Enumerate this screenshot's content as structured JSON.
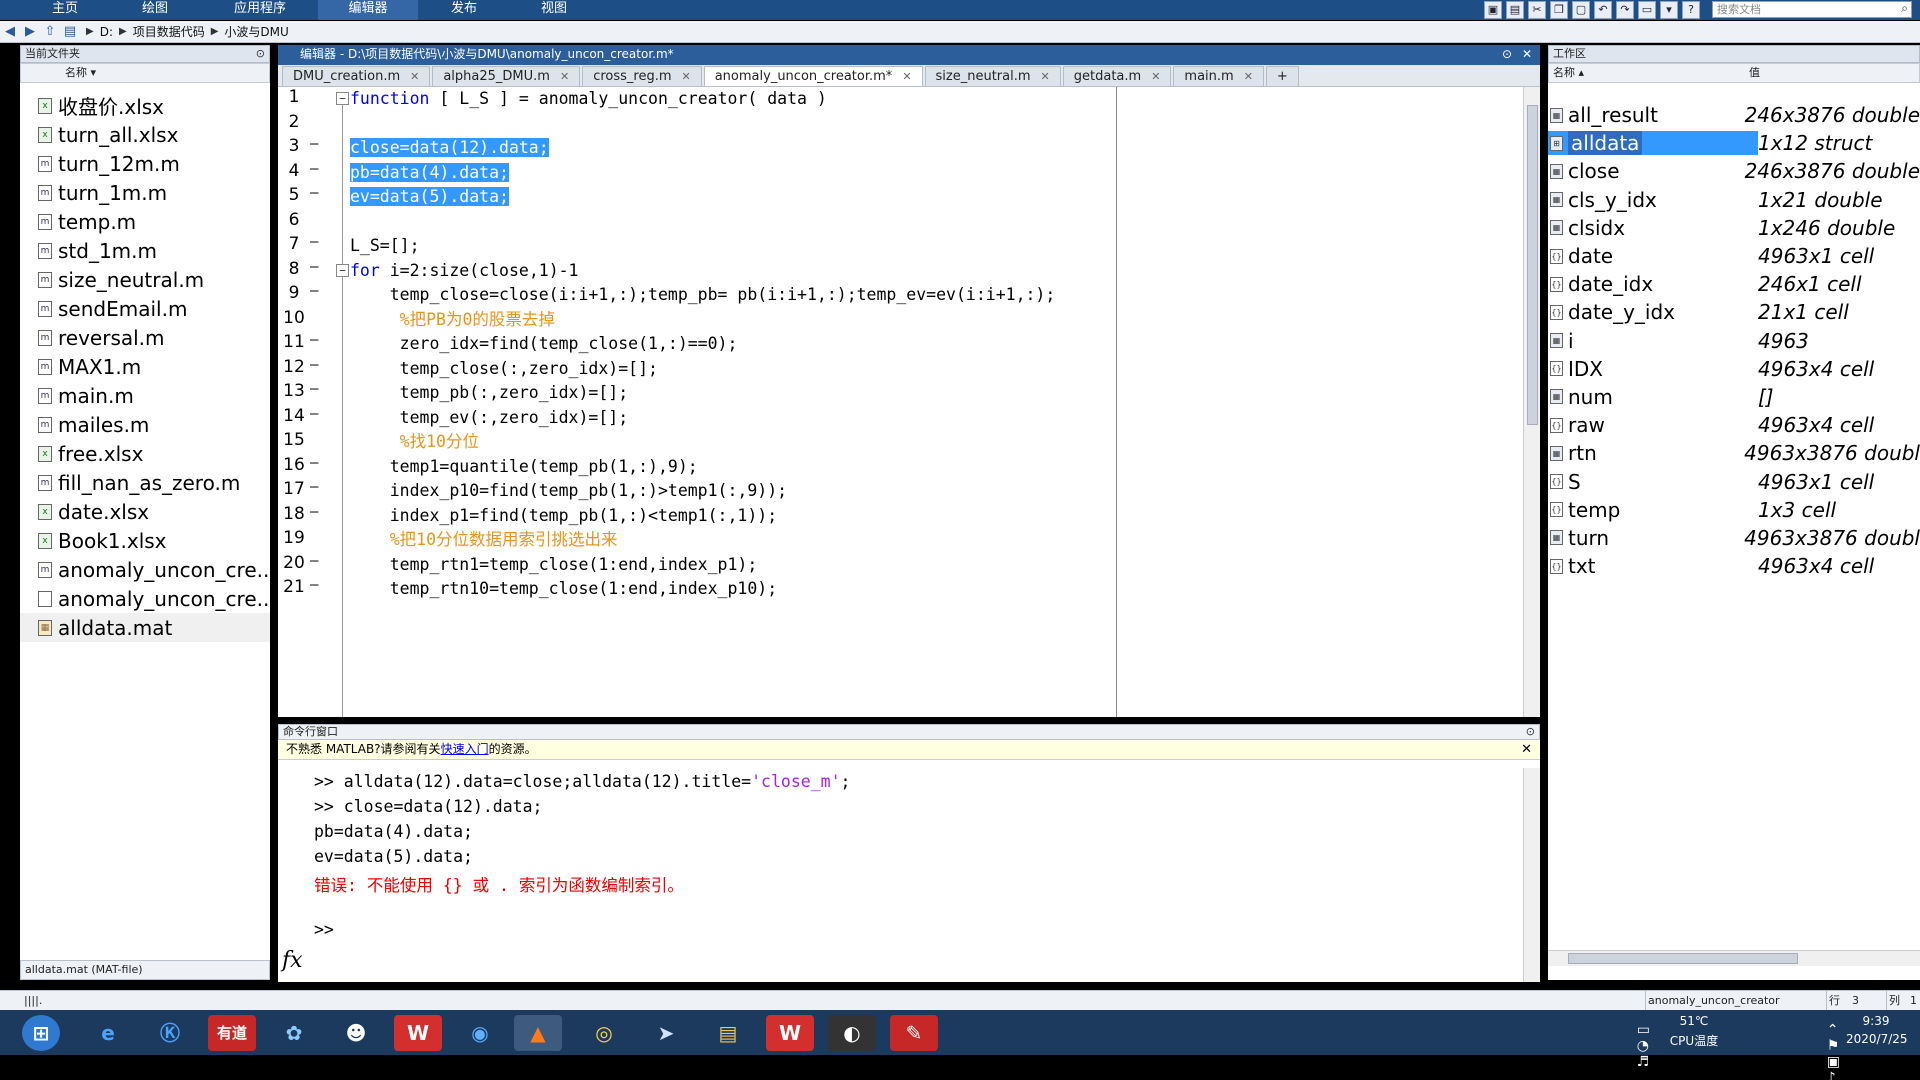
{
  "ribbon": {
    "tabs": [
      "主页",
      "绘图",
      "应用程序",
      "编辑器",
      "发布",
      "视图"
    ],
    "active_tab": "编辑器",
    "search_placeholder": "搜索文档"
  },
  "address": {
    "crumbs": [
      "D:",
      "项目数据代码",
      "小波与DMU"
    ]
  },
  "current_folder": {
    "title": "当前文件夹",
    "column_name": "名称 ▾",
    "files": [
      {
        "name": "收盘价.xlsx",
        "type": "xlsx"
      },
      {
        "name": "turn_all.xlsx",
        "type": "xlsx"
      },
      {
        "name": "turn_12m.m",
        "type": "m"
      },
      {
        "name": "turn_1m.m",
        "type": "m"
      },
      {
        "name": "temp.m",
        "type": "m"
      },
      {
        "name": "std_1m.m",
        "type": "m"
      },
      {
        "name": "size_neutral.m",
        "type": "m"
      },
      {
        "name": "sendEmail.m",
        "type": "m"
      },
      {
        "name": "reversal.m",
        "type": "m"
      },
      {
        "name": "MAX1.m",
        "type": "m"
      },
      {
        "name": "main.m",
        "type": "m"
      },
      {
        "name": "mailes.m",
        "type": "m"
      },
      {
        "name": "free.xlsx",
        "type": "xlsx"
      },
      {
        "name": "fill_nan_as_zero.m",
        "type": "m"
      },
      {
        "name": "date.xlsx",
        "type": "xlsx"
      },
      {
        "name": "Book1.xlsx",
        "type": "xlsx"
      },
      {
        "name": "anomaly_uncon_cre...",
        "type": "m"
      },
      {
        "name": "anomaly_uncon_cre...",
        "type": "asv"
      },
      {
        "name": "alldata.mat",
        "type": "mat"
      }
    ],
    "selected_file": "alldata.mat",
    "details": "alldata.mat  (MAT-file)"
  },
  "editor": {
    "title": "编辑器 - D:\\项目数据代码\\小波与DMU\\anomaly_uncon_creator.m*",
    "tabs": [
      "DMU_creation.m",
      "alpha25_DMU.m",
      "cross_reg.m",
      "anomaly_uncon_creator.m*",
      "size_neutral.m",
      "getdata.m",
      "main.m"
    ],
    "active_tab": "anomaly_uncon_creator.m*",
    "add_tab": "+",
    "lines": [
      {
        "n": "1",
        "code": "function [ L_S ] = anomaly_uncon_creator( data )"
      },
      {
        "n": "2",
        "code": ""
      },
      {
        "n": "3",
        "code": "close=data(12).data;"
      },
      {
        "n": "4",
        "code": "pb=data(4).data;"
      },
      {
        "n": "5",
        "code": "ev=data(5).data;"
      },
      {
        "n": "6",
        "code": ""
      },
      {
        "n": "7",
        "code": "L_S=[];"
      },
      {
        "n": "8",
        "code": "for i=2:size(close,1)-1"
      },
      {
        "n": "9",
        "code": "    temp_close=close(i:i+1,:);temp_pb= pb(i:i+1,:);temp_ev=ev(i:i+1,:);"
      },
      {
        "n": "10",
        "code": "     %把PB为0的股票去掉"
      },
      {
        "n": "11",
        "code": "     zero_idx=find(temp_close(1,:)==0);"
      },
      {
        "n": "12",
        "code": "     temp_close(:,zero_idx)=[];"
      },
      {
        "n": "13",
        "code": "     temp_pb(:,zero_idx)=[];"
      },
      {
        "n": "14",
        "code": "     temp_ev(:,zero_idx)=[];"
      },
      {
        "n": "15",
        "code": "     %找10分位"
      },
      {
        "n": "16",
        "code": "    temp1=quantile(temp_pb(1,:),9);"
      },
      {
        "n": "17",
        "code": "    index_p10=find(temp_pb(1,:)>temp1(:,9));"
      },
      {
        "n": "18",
        "code": "    index_p1=find(temp_pb(1,:)<temp1(:,1));"
      },
      {
        "n": "19",
        "code": "    %把10分位数据用索引挑选出来"
      },
      {
        "n": "20",
        "code": "    temp_rtn1=temp_close(1:end,index_p1);"
      },
      {
        "n": "21",
        "code": "    temp_rtn10=temp_close(1:end,index_p10);"
      }
    ]
  },
  "command_window": {
    "title": "命令行窗口",
    "notice_prefix": "不熟悉 MATLAB?请参阅有关",
    "notice_link": "快速入门",
    "notice_suffix": "的资源。",
    "lines": [
      {
        "text_before": ">> alldata(12).data=close;alldata(12).title=",
        "string": "'close_m'",
        "text_after": ";"
      },
      {
        "text": ">> close=data(12).data;"
      },
      {
        "text": "pb=data(4).data;"
      },
      {
        "text": "ev=data(5).data;"
      },
      {
        "error": "错误: 不能使用 {} 或 . 索引为函数编制索引。"
      }
    ],
    "prompt": ">>",
    "fx": "fx"
  },
  "workspace": {
    "title": "工作区",
    "col_name": "名称 ▴",
    "col_value": "值",
    "variables": [
      {
        "name": "all_result",
        "value": "246x3876 double",
        "kind": "num"
      },
      {
        "name": "alldata",
        "value": "1x12 struct",
        "kind": "struct"
      },
      {
        "name": "close",
        "value": "246x3876 double",
        "kind": "num"
      },
      {
        "name": "cls_y_idx",
        "value": "1x21 double",
        "kind": "num"
      },
      {
        "name": "clsidx",
        "value": "1x246 double",
        "kind": "num"
      },
      {
        "name": "date",
        "value": "4963x1 cell",
        "kind": "cell"
      },
      {
        "name": "date_idx",
        "value": "246x1 cell",
        "kind": "cell"
      },
      {
        "name": "date_y_idx",
        "value": "21x1 cell",
        "kind": "cell"
      },
      {
        "name": "i",
        "value": "4963",
        "kind": "num"
      },
      {
        "name": "IDX",
        "value": "4963x4 cell",
        "kind": "cell"
      },
      {
        "name": "num",
        "value": "[]",
        "kind": "num"
      },
      {
        "name": "raw",
        "value": "4963x4 cell",
        "kind": "cell"
      },
      {
        "name": "rtn",
        "value": "4963x3876 doubl",
        "kind": "num"
      },
      {
        "name": "S",
        "value": "4963x1 cell",
        "kind": "cell"
      },
      {
        "name": "temp",
        "value": "1x3 cell",
        "kind": "cell"
      },
      {
        "name": "turn",
        "value": "4963x3876 doubl",
        "kind": "num"
      },
      {
        "name": "txt",
        "value": "4963x4 cell",
        "kind": "cell"
      }
    ],
    "selected": "alldata"
  },
  "status_bar": {
    "function_name": "anomaly_uncon_creator",
    "row_label": "行",
    "row_value": "3",
    "col_label": "列",
    "col_value": "1"
  },
  "taskbar": {
    "apps": [
      "start",
      "ie",
      "k",
      "有道",
      "baidu-netdisk",
      "qq",
      "wps-writer",
      "earth",
      "matlab",
      "chrome",
      "feishu",
      "explorer",
      "wps",
      "obs",
      "pdf"
    ],
    "youdao_label": "有道",
    "cpu_temp": "51℃",
    "cpu_label": "CPU温度",
    "time": "9:39",
    "date": "2020/7/25"
  },
  "colors": {
    "ribbon": "#1d4f86",
    "selection": "#3399ff",
    "keyword": "#0000ff",
    "comment": "#e8941a",
    "error": "#e00000",
    "taskbar": "#1c3a5e"
  }
}
